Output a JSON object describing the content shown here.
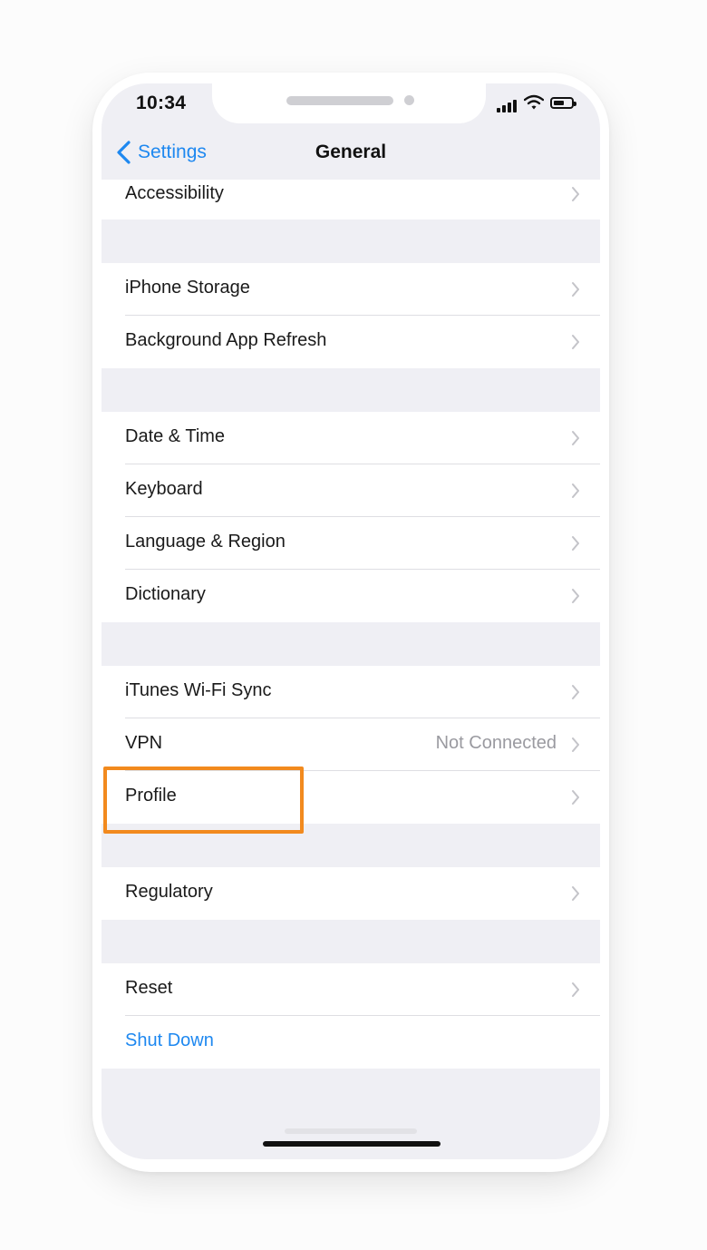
{
  "status_bar": {
    "time": "10:34"
  },
  "nav": {
    "back_label": "Settings",
    "title": "General"
  },
  "groups": [
    {
      "rows": [
        {
          "label": "Accessibility",
          "chevron": true
        }
      ]
    },
    {
      "rows": [
        {
          "label": "iPhone Storage",
          "chevron": true
        },
        {
          "label": "Background App Refresh",
          "chevron": true
        }
      ]
    },
    {
      "rows": [
        {
          "label": "Date & Time",
          "chevron": true
        },
        {
          "label": "Keyboard",
          "chevron": true
        },
        {
          "label": "Language & Region",
          "chevron": true
        },
        {
          "label": "Dictionary",
          "chevron": true
        }
      ]
    },
    {
      "rows": [
        {
          "label": "iTunes Wi-Fi Sync",
          "chevron": true
        },
        {
          "label": "VPN",
          "value": "Not Connected",
          "chevron": true
        },
        {
          "label": "Profile",
          "chevron": true,
          "highlighted": true
        }
      ]
    },
    {
      "rows": [
        {
          "label": "Regulatory",
          "chevron": true
        }
      ]
    },
    {
      "rows": [
        {
          "label": "Reset",
          "chevron": true
        },
        {
          "label": "Shut Down",
          "chevron": false,
          "style": "link"
        }
      ]
    }
  ],
  "colors": {
    "accent": "#1e88f0",
    "highlight_outline": "#f28a1e",
    "grouped_background": "#efeff4"
  }
}
